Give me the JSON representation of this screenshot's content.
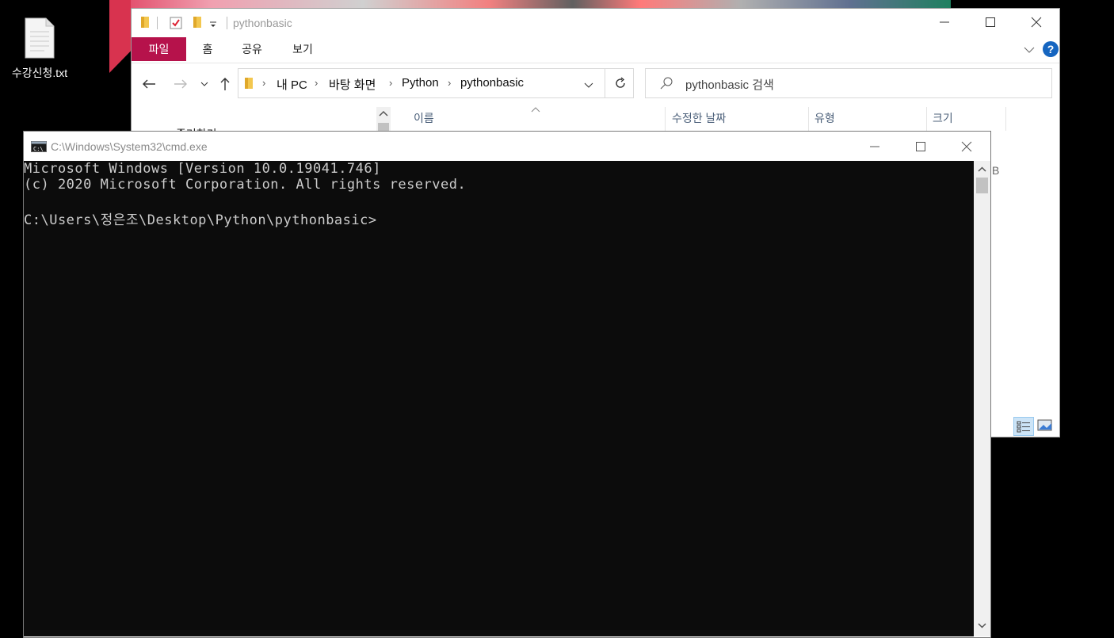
{
  "desktop": {
    "icon_label": "수강신청.txt",
    "icon": "text-file-icon"
  },
  "explorer": {
    "title": "pythonbasic",
    "ribbon_tabs": [
      "파일",
      "홈",
      "공유",
      "보기"
    ],
    "breadcrumb": [
      "내 PC",
      "바탕 화면",
      "Python",
      "pythonbasic"
    ],
    "search_placeholder": "pythonbasic 검색",
    "columns": [
      "이름",
      "수정한 날짜",
      "유형",
      "크기"
    ],
    "partial_nav_label": "즐겨찾기",
    "partial_size_suffix": "B",
    "colors": {
      "file_tab": "#b6124b",
      "help": "#1565c0"
    }
  },
  "cmd": {
    "title": "C:\\Windows\\System32\\cmd.exe",
    "lines": [
      "Microsoft Windows [Version 10.0.19041.746]",
      "(c) 2020 Microsoft Corporation. All rights reserved.",
      "",
      "C:\\Users\\정은조\\Desktop\\Python\\pythonbasic>"
    ]
  }
}
